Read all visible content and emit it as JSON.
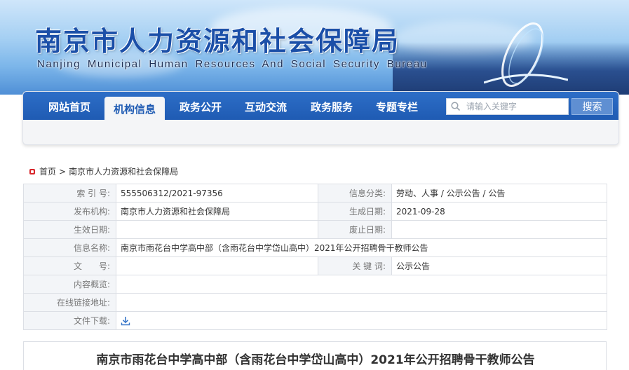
{
  "banner": {
    "title_cn": "南京市人力资源和社会保障局",
    "title_en": "Nanjing Municipal Human Resources And Social Security Bureau"
  },
  "nav": {
    "items": [
      {
        "label": "网站首页"
      },
      {
        "label": "机构信息",
        "active": true
      },
      {
        "label": "政务公开"
      },
      {
        "label": "互动交流"
      },
      {
        "label": "政务服务"
      },
      {
        "label": "专题专栏"
      }
    ],
    "search_placeholder": "请输入关键字",
    "search_button": "搜索",
    "search_icon": "search-icon"
  },
  "breadcrumb": {
    "home": "首页",
    "separator": ">",
    "current": "南京市人力资源和社会保障局"
  },
  "info": {
    "index_label": "索 引 号:",
    "index_value": "555506312/2021-97356",
    "category_label": "信息分类:",
    "category_value": "劳动、人事 / 公示公告 / 公告",
    "publisher_label": "发布机构:",
    "publisher_value": "南京市人力资源和社会保障局",
    "created_label": "生成日期:",
    "created_value": "2021-09-28",
    "effective_label": "生效日期:",
    "effective_value": "",
    "expiry_label": "废止日期:",
    "expiry_value": "",
    "name_label": "信息名称:",
    "name_value": "南京市雨花台中学高中部（含雨花台中学岱山高中）2021年公开招聘骨干教师公告",
    "docno_label": "文　　号:",
    "docno_value": "",
    "keywords_label": "关 键 词:",
    "keywords_value": "公示公告",
    "summary_label": "内容概览:",
    "summary_value": "",
    "link_label": "在线链接地址:",
    "link_value": "",
    "download_label": "文件下载:",
    "download_icon": "download-icon"
  },
  "article": {
    "title": "南京市雨花台中学高中部（含雨花台中学岱山高中）2021年公开招聘骨干教师公告"
  },
  "colors": {
    "nav_blue": "#1f5bb3",
    "accent_red": "#d8262b",
    "label_bg": "#f3f5f8"
  }
}
